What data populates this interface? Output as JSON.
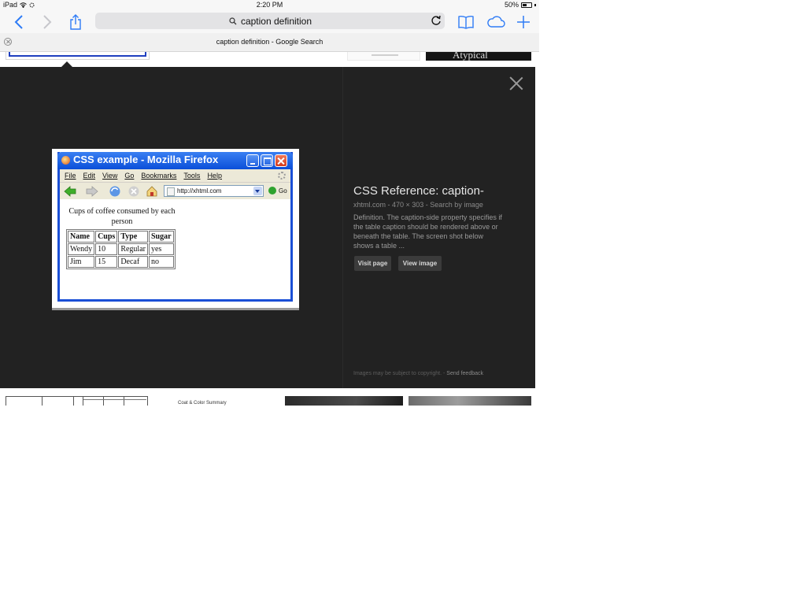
{
  "status_bar": {
    "device": "iPad",
    "time": "2:20 PM",
    "battery": "50%"
  },
  "toolbar": {
    "address_text": "caption definition",
    "icons": [
      "back-icon",
      "forward-icon",
      "share-icon",
      "search-icon",
      "reload-icon",
      "bookmarks-icon",
      "icloud-tabs-icon",
      "new-tab-icon"
    ],
    "accent_color": "#2f7cf6"
  },
  "tab": {
    "title": "caption definition - Google Search"
  },
  "results_top": {
    "thumb3_text": "Atypical"
  },
  "preview": {
    "window_title": "CSS example - Mozilla Firefox",
    "menu": [
      "File",
      "Edit",
      "View",
      "Go",
      "Bookmarks",
      "Tools",
      "Help"
    ],
    "url": "http://xhtml.com",
    "go_label": "Go",
    "caption": "Cups of coffee consumed by each person",
    "table": {
      "headers": [
        "Name",
        "Cups",
        "Type",
        "Sugar"
      ],
      "rows": [
        [
          "Wendy",
          "10",
          "Regular",
          "yes"
        ],
        [
          "Jim",
          "15",
          "Decaf",
          "no"
        ]
      ]
    }
  },
  "info": {
    "title": "CSS Reference: caption-",
    "meta": "xhtml.com - 470 × 303 - Search by image",
    "description": "Definition. The caption-side property specifies if the table caption should be rendered above or beneath the table. The screen shot below shows a table ...",
    "visit_label": "Visit page",
    "view_label": "View image",
    "copyright": "Images may be subject to copyright.",
    "separator": " - ",
    "feedback": "Send feedback"
  },
  "results_bottom": {
    "thumb2_text": "Coat & Color Summary"
  }
}
